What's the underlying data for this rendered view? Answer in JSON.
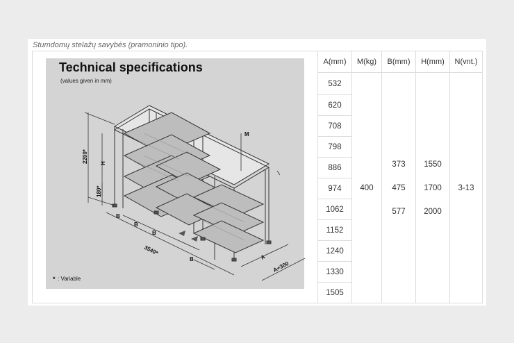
{
  "caption": "Stumdomų stelažų savybės (pramoninio tipo).",
  "drawing": {
    "title": "Technical specifications",
    "subtitle": "(values given in mm)",
    "variable_note": ": Variable",
    "labels": {
      "m": "M",
      "h": "H",
      "h2200": "2200*",
      "h180": "180*",
      "b": "B",
      "w3540": "3540*",
      "a": "A",
      "a300": "A+300"
    }
  },
  "table": {
    "headers": [
      "A(mm)",
      "M(kg)",
      "B(mm)",
      "H(mm)",
      "N(vnt.)"
    ],
    "a_values": [
      "532",
      "620",
      "708",
      "798",
      "886",
      "974",
      "1062",
      "1152",
      "1240",
      "1330",
      "1505"
    ],
    "m_value": "400",
    "b_values": [
      "373",
      "475",
      "577"
    ],
    "h_values": [
      "1550",
      "1700",
      "2000"
    ],
    "n_value": "3-13"
  }
}
